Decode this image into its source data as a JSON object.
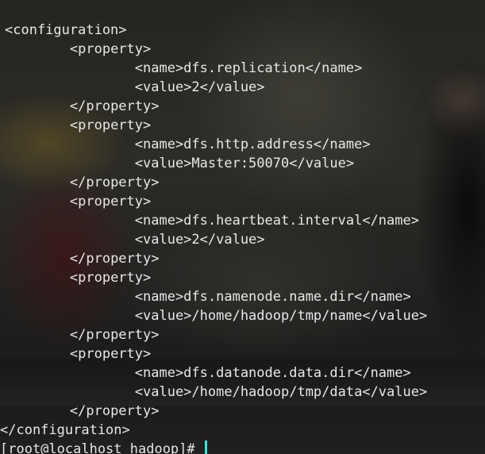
{
  "terminal": {
    "lines": [
      {
        "indent": "",
        "text": "<configuration>"
      },
      {
        "indent": "        ",
        "text": "<property>"
      },
      {
        "indent": "                ",
        "text": "<name>dfs.replication</name>"
      },
      {
        "indent": "                ",
        "text": "<value>2</value>"
      },
      {
        "indent": "        ",
        "text": "</property>"
      },
      {
        "indent": "        ",
        "text": "<property>"
      },
      {
        "indent": "                ",
        "text": "<name>dfs.http.address</name>"
      },
      {
        "indent": "                ",
        "text": "<value>Master:50070</value>"
      },
      {
        "indent": "        ",
        "text": "</property>"
      },
      {
        "indent": "        ",
        "text": "<property>"
      },
      {
        "indent": "                ",
        "text": "<name>dfs.heartbeat.interval</name>"
      },
      {
        "indent": "                ",
        "text": "<value>2</value>"
      },
      {
        "indent": "        ",
        "text": "</property>"
      },
      {
        "indent": "        ",
        "text": "<property>"
      },
      {
        "indent": "                ",
        "text": "<name>dfs.namenode.name.dir</name>"
      },
      {
        "indent": "                ",
        "text": "<value>/home/hadoop/tmp/name</value>"
      },
      {
        "indent": "        ",
        "text": "</property>"
      },
      {
        "indent": "        ",
        "text": "<property>"
      },
      {
        "indent": "                ",
        "text": "<name>dfs.datanode.data.dir</name>"
      },
      {
        "indent": "                ",
        "text": "<value>/home/hadoop/tmp/data</value>"
      },
      {
        "indent": "        ",
        "text": "</property>"
      },
      {
        "indent": "",
        "text": "</configuration>"
      }
    ],
    "prompt": "[root@localhost hadoop]# ",
    "cursor_color": "#3fe0e0",
    "text_color": "#e8e8e8"
  }
}
